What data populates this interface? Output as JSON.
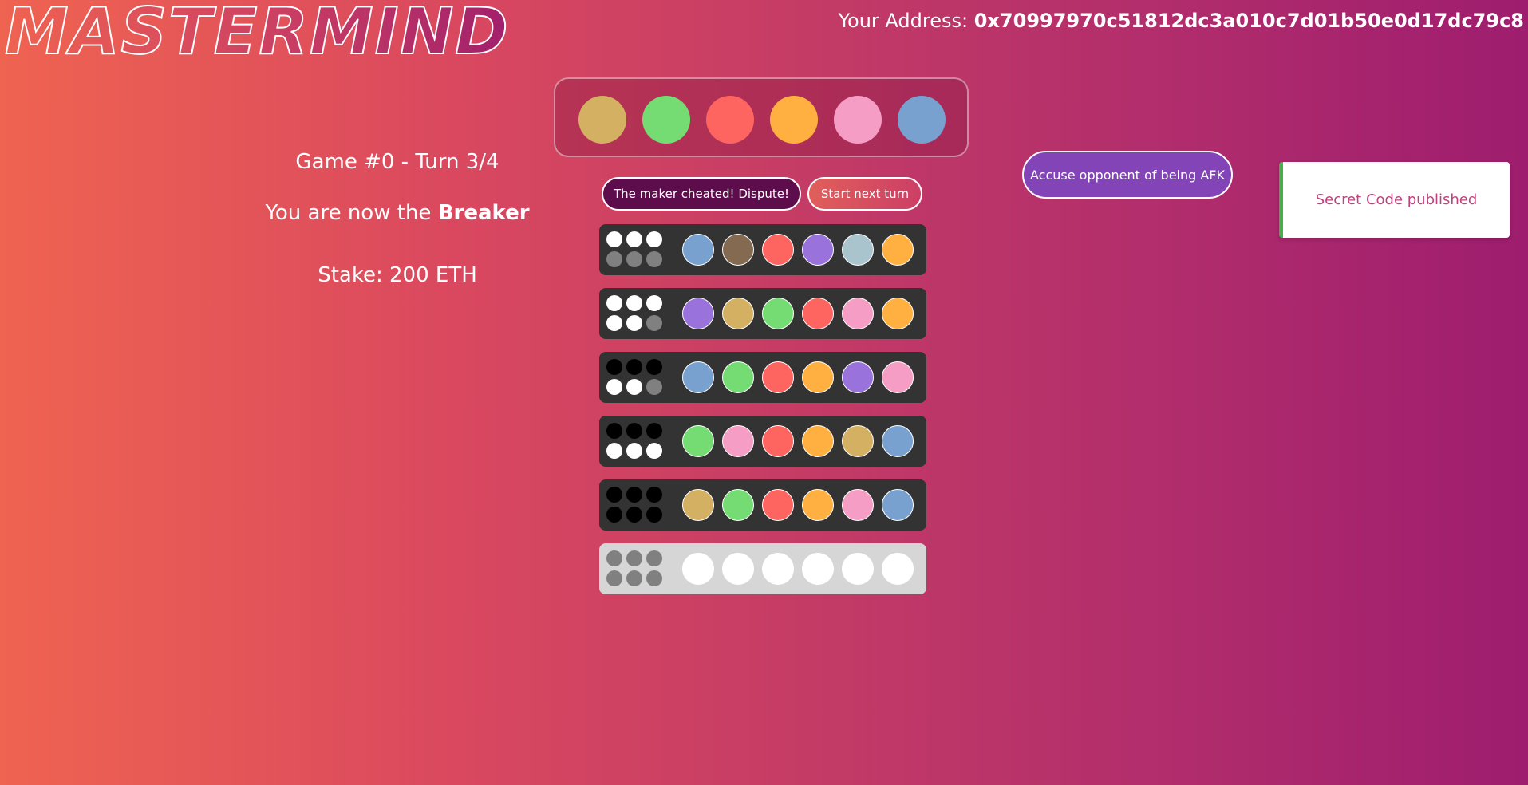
{
  "header": {
    "logo": "MASTERMIND",
    "address_label": "Your Address:",
    "address_value": "0x70997970c51812dc3a010c7d01b50e0d17dc79c8"
  },
  "game": {
    "title": "Game #0 - Turn 3/4",
    "role_prefix": "You are now the",
    "role_name": "Breaker",
    "stake": "Stake: 200 ETH"
  },
  "colors": {
    "tan": "#d4b062",
    "green": "#74dc73",
    "red": "#fe6561",
    "orange": "#ffb040",
    "pink": "#f59dc4",
    "blue": "#78a1d0",
    "brown": "#856a52",
    "purple": "#9a72dc",
    "lightblue": "#a9c4cd",
    "empty": "#ffffff"
  },
  "secret_code": [
    "tan",
    "green",
    "red",
    "orange",
    "pink",
    "blue"
  ],
  "buttons": {
    "dispute": "The maker cheated! Dispute!",
    "next_turn": "Start next turn",
    "afk": "Accuse opponent of being AFK"
  },
  "notification": "Secret Code published",
  "guesses": [
    {
      "pegs": [
        "blue",
        "brown",
        "red",
        "purple",
        "lightblue",
        "orange"
      ],
      "feedback": [
        "white",
        "white",
        "white",
        "empty",
        "empty",
        "empty"
      ]
    },
    {
      "pegs": [
        "purple",
        "tan",
        "green",
        "red",
        "pink",
        "orange"
      ],
      "feedback": [
        "white",
        "white",
        "white",
        "white",
        "white",
        "empty"
      ]
    },
    {
      "pegs": [
        "blue",
        "green",
        "red",
        "orange",
        "purple",
        "pink"
      ],
      "feedback": [
        "black",
        "black",
        "black",
        "white",
        "white",
        "empty"
      ]
    },
    {
      "pegs": [
        "green",
        "pink",
        "red",
        "orange",
        "tan",
        "blue"
      ],
      "feedback": [
        "black",
        "black",
        "black",
        "white",
        "white",
        "white"
      ]
    },
    {
      "pegs": [
        "tan",
        "green",
        "red",
        "orange",
        "pink",
        "blue"
      ],
      "feedback": [
        "black",
        "black",
        "black",
        "black",
        "black",
        "black"
      ]
    },
    {
      "pegs": [
        "empty",
        "empty",
        "empty",
        "empty",
        "empty",
        "empty"
      ],
      "feedback": [
        "empty",
        "empty",
        "empty",
        "empty",
        "empty",
        "empty"
      ],
      "current": true
    }
  ]
}
